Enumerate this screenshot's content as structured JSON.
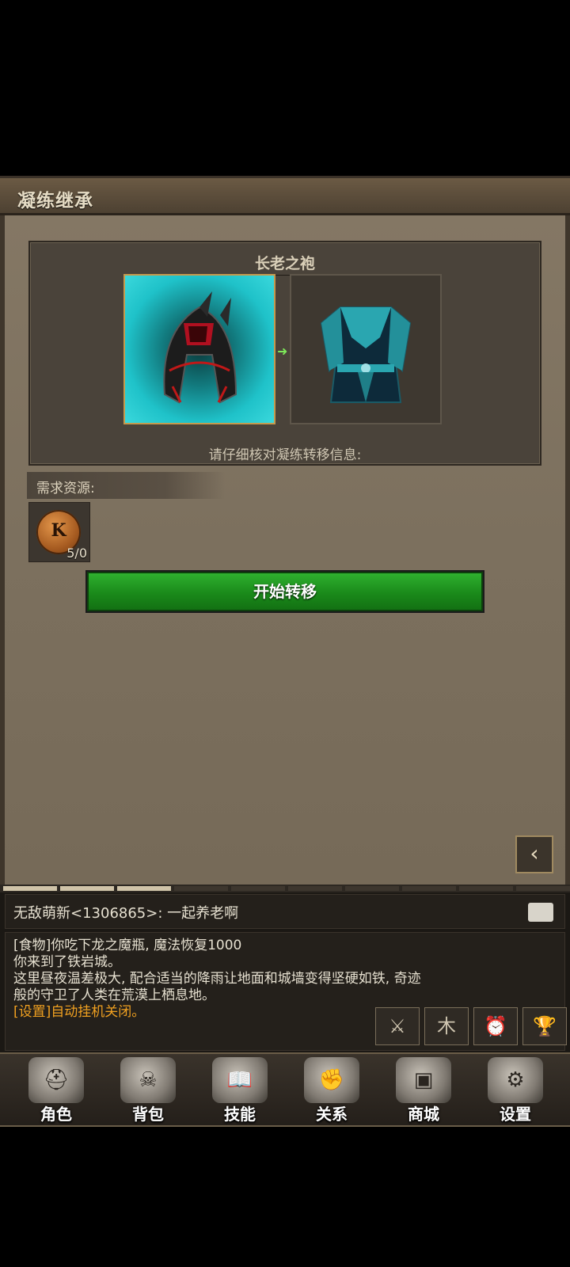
{
  "title": "凝练继承",
  "item": {
    "name": "长老之袍",
    "source_icon": "dark-helmet-icon",
    "target_icon": "teal-robe-icon",
    "info_text": "请仔细核对凝练转移信息:"
  },
  "resources": {
    "header": "需求资源:",
    "items": [
      {
        "icon": "k-coin-icon",
        "letter": "K",
        "count": "5/0"
      }
    ]
  },
  "start_button": "开始转移",
  "back_icon": "back-arrow-icon",
  "chat": {
    "tabs_count": 10,
    "active_tabs": [
      0,
      1,
      2
    ],
    "message": "无敌萌新<1306865>: 一起养老啊",
    "log": [
      {
        "text": "[食物]你吃下龙之魔瓶, 魔法恢复1000",
        "color": "#e6e0d0"
      },
      {
        "text": "你来到了铁岩城。",
        "color": "#e6e0d0"
      },
      {
        "text": "这里昼夜温差极大, 配合适当的降雨让地面和城墙变得坚硬如铁, 奇迹",
        "color": "#e6e0d0"
      },
      {
        "text": "般的守卫了人类在荒漠上栖息地。",
        "color": "#e6e0d0"
      },
      {
        "text": "[设置]自动挂机关闭。",
        "color": "#f0a020"
      }
    ],
    "quick_buttons": [
      {
        "name": "auto-battle-icon",
        "glyph": "⚔"
      },
      {
        "name": "tree-icon",
        "glyph": "木"
      },
      {
        "name": "clock-icon",
        "glyph": "⏰"
      },
      {
        "name": "trophy-icon",
        "glyph": "🏆"
      }
    ]
  },
  "nav": [
    {
      "label": "角色",
      "icon": "helmet-icon",
      "glyph": "⛑"
    },
    {
      "label": "背包",
      "icon": "bag-icon",
      "glyph": "☠"
    },
    {
      "label": "技能",
      "icon": "spellbook-icon",
      "glyph": "📖"
    },
    {
      "label": "关系",
      "icon": "handshake-icon",
      "glyph": "✊"
    },
    {
      "label": "商城",
      "icon": "chest-icon",
      "glyph": "▣"
    },
    {
      "label": "设置",
      "icon": "gear-icon",
      "glyph": "⚙"
    }
  ]
}
